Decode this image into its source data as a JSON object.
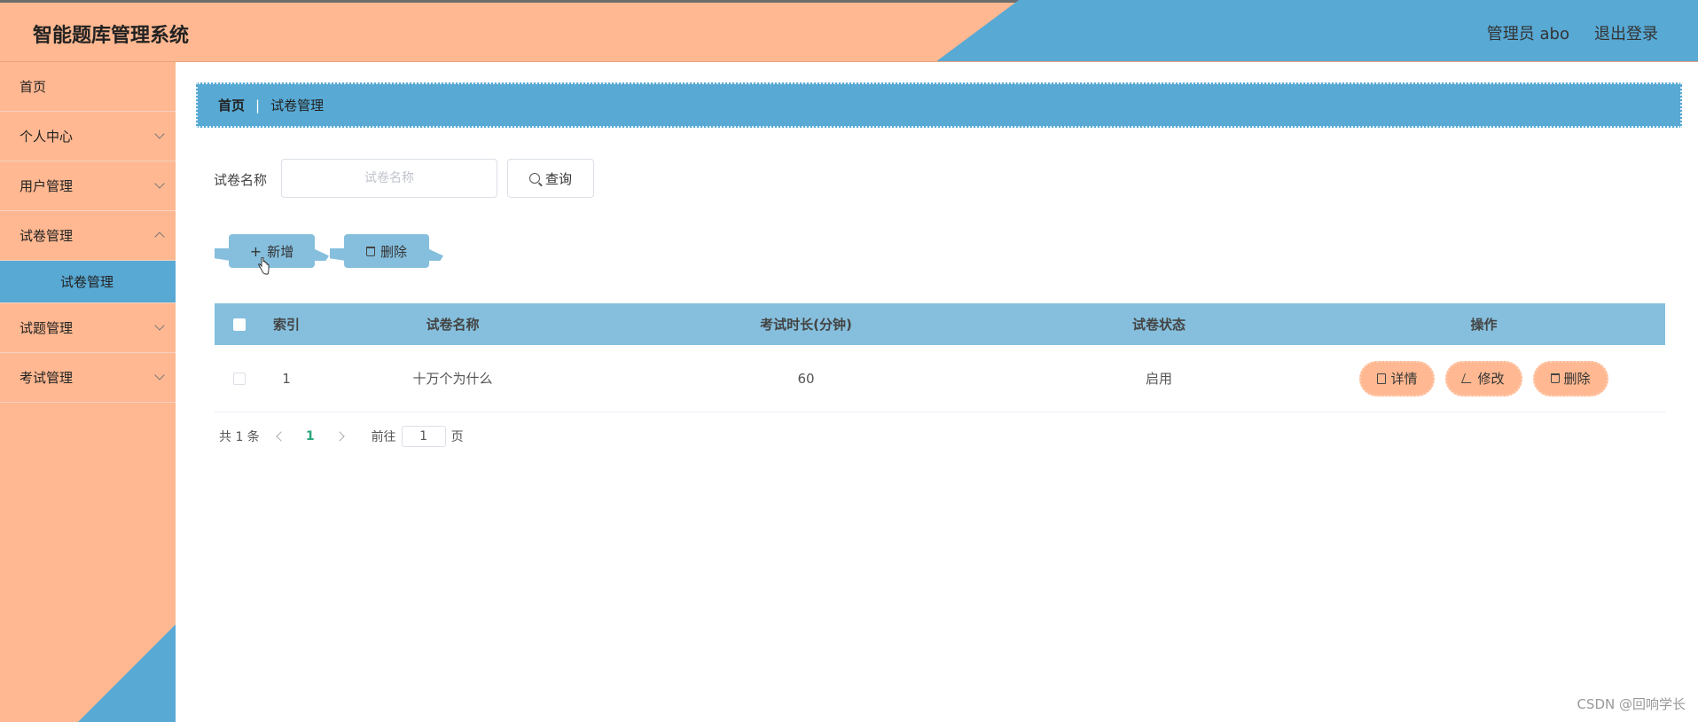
{
  "header": {
    "title": "智能题库管理系统",
    "user_label": "管理员 abo",
    "logout_label": "退出登录"
  },
  "sidebar": {
    "items": [
      {
        "label": "首页"
      },
      {
        "label": "个人中心"
      },
      {
        "label": "用户管理"
      },
      {
        "label": "试卷管理"
      },
      {
        "label": "试题管理"
      },
      {
        "label": "考试管理"
      }
    ],
    "active_sub": "试卷管理"
  },
  "breadcrumb": {
    "home": "首页",
    "separator": "|",
    "current": "试卷管理"
  },
  "search": {
    "label": "试卷名称",
    "placeholder": "试卷名称",
    "button": "查询"
  },
  "actions": {
    "add": "新增",
    "delete": "删除"
  },
  "table": {
    "columns": [
      "索引",
      "试卷名称",
      "考试时长(分钟)",
      "试卷状态",
      "操作"
    ],
    "rows": [
      {
        "index": "1",
        "name": "十万个为什么",
        "duration": "60",
        "status": "启用",
        "ops": {
          "detail": "详情",
          "edit": "修改",
          "delete": "删除"
        }
      }
    ]
  },
  "pagination": {
    "total": "共 1 条",
    "current_page": "1",
    "goto_label": "前往",
    "goto_value": "1",
    "page_unit": "页"
  },
  "watermark": "CSDN @回响学长",
  "colors": {
    "peach": "#ffb891",
    "blue": "#58a9d4",
    "light_blue": "#85bfdd"
  }
}
